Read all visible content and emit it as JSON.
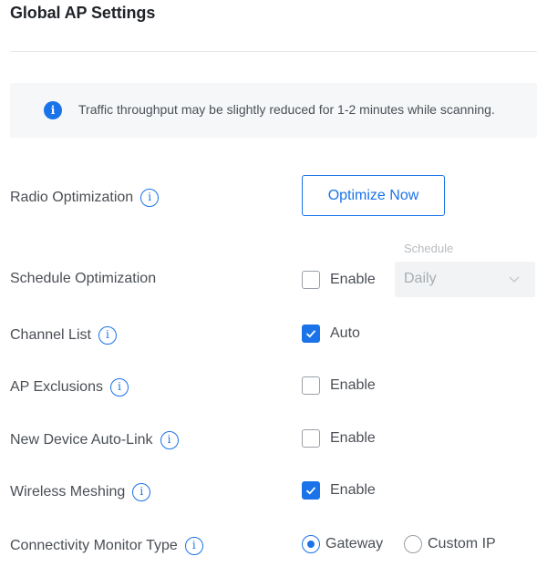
{
  "page": {
    "title": "Global AP Settings"
  },
  "banner": {
    "icon": "info-icon",
    "message": "Traffic throughput may be slightly reduced for 1-2 minutes while scanning."
  },
  "radio_optimization": {
    "label": "Radio Optimization",
    "button": "Optimize Now"
  },
  "schedule_optimization": {
    "label": "Schedule Optimization",
    "checkbox_label": "Enable",
    "checked": false,
    "schedule_label": "Schedule",
    "schedule_value": "Daily",
    "disabled": true
  },
  "channel_list": {
    "label": "Channel List",
    "checkbox_label": "Auto",
    "checked": true
  },
  "ap_exclusions": {
    "label": "AP Exclusions",
    "checkbox_label": "Enable",
    "checked": false
  },
  "new_device_auto_link": {
    "label": "New Device Auto-Link",
    "checkbox_label": "Enable",
    "checked": false
  },
  "wireless_meshing": {
    "label": "Wireless Meshing",
    "checkbox_label": "Enable",
    "checked": true
  },
  "connectivity_monitor": {
    "label": "Connectivity Monitor Type",
    "options": [
      "Gateway",
      "Custom IP"
    ],
    "selected": "Gateway"
  },
  "colors": {
    "accent": "#1a73e8",
    "text": "#4a4f55",
    "banner_bg": "#f5f7f8"
  }
}
